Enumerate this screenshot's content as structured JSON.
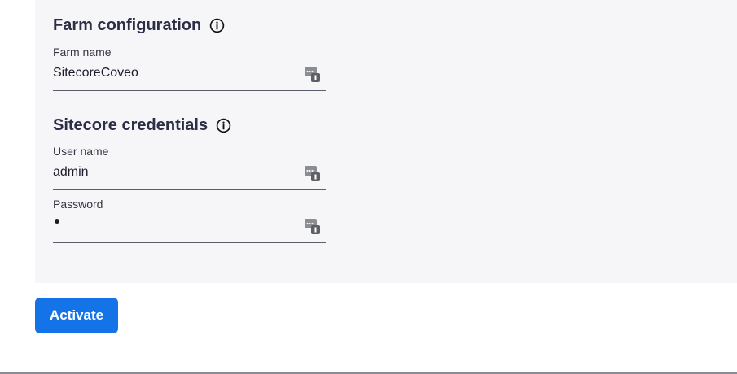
{
  "farm_section": {
    "title": "Farm configuration",
    "fields": {
      "farm_name": {
        "label": "Farm name",
        "value": "SitecoreCoveo"
      }
    }
  },
  "credentials_section": {
    "title": "Sitecore credentials",
    "fields": {
      "user_name": {
        "label": "User name",
        "value": "admin"
      },
      "password": {
        "label": "Password"
      }
    }
  },
  "actions": {
    "activate_label": "Activate"
  },
  "icons": {
    "info": "info-circle-icon",
    "password_manager": "password-manager-icon"
  },
  "colors": {
    "primary": "#1473e6",
    "panel_bg": "#f6f6f9",
    "heading": "#2b2e45"
  }
}
